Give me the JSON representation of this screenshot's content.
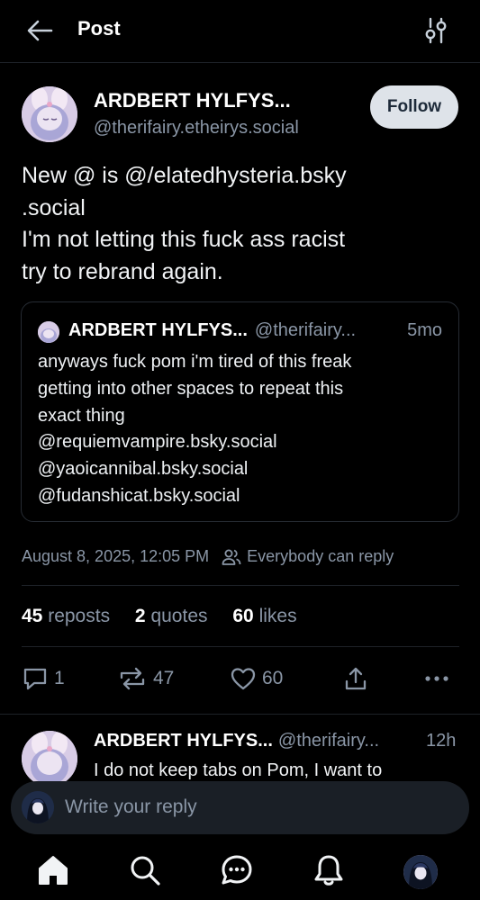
{
  "header": {
    "title": "Post"
  },
  "post": {
    "author_name": "ARDBERT HYLFYS...",
    "author_handle": "@therifairy.etheirys.social",
    "follow_label": "Follow",
    "text_lines": [
      "New @ is @/elatedhysteria.bsky",
      ".social",
      "I'm not letting this fuck ass racist",
      "try to rebrand again."
    ],
    "quote": {
      "author_name": "ARDBERT HYLFYS...",
      "author_handle": "@therifairy...",
      "time": "5mo",
      "lines": [
        "anyways fuck pom i'm tired of this freak",
        "getting into other spaces to repeat this",
        "exact thing",
        "@requiemvampire.bsky.social",
        "@yaoicannibal.bsky.social",
        "@fudanshicat.bsky.social"
      ]
    },
    "timestamp": "August 8, 2025, 12:05 PM",
    "reply_setting": "Everybody can reply",
    "stats": {
      "reposts_count": "45",
      "reposts_label": "reposts",
      "quotes_count": "2",
      "quotes_label": "quotes",
      "likes_count": "60",
      "likes_label": "likes"
    },
    "actions": {
      "replies": "1",
      "reposts": "47",
      "likes": "60"
    }
  },
  "reply": {
    "author_name": "ARDBERT HYLFYS...",
    "author_handle": "@therifairy...",
    "time": "12h",
    "text": "I do not keep tabs on Pom, I want to"
  },
  "composer": {
    "placeholder": "Write your reply"
  },
  "tabs": [
    "home-icon",
    "search-icon",
    "chat-icon",
    "bell-icon",
    "profile-avatar"
  ],
  "colors": {
    "background": "#000000",
    "muted": "#8a96a6",
    "follow_bg": "#dee3e9"
  }
}
